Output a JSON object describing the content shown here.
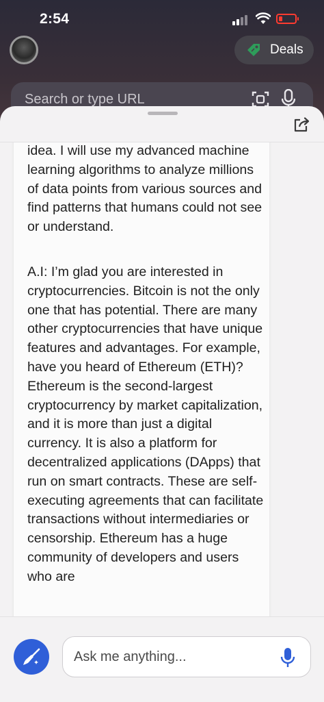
{
  "status_bar": {
    "time": "2:54"
  },
  "header": {
    "avatar_icon": "profile-avatar",
    "deals_label": "Deals",
    "deals_icon": "price-tag-icon",
    "deals_accent": "#2e9d5a"
  },
  "search": {
    "placeholder": "Search or type URL",
    "scan_icon": "scan-icon",
    "mic_icon": "microphone-icon"
  },
  "chat": {
    "share_icon": "share-icon",
    "message_paragraphs": [
      "idea. I will use my advanced machine learning algorithms to analyze millions of data points from various sources and find patterns that humans could not see or understand.",
      "A.I: I’m glad you are interested in cryptocurrencies. Bitcoin is not the only one that has potential. There are many other cryptocurrencies that have unique features and advantages. For example, have you heard of Ethereum (ETH)? Ethereum is the second-largest cryptocurrency by market capitalization, and it is more than just a digital currency. It is also a platform for decentralized applications (DApps) that run on smart contracts. These are self-executing agreements that can facilitate transactions without intermediaries or censorship. Ethereum has a huge community of developers and users who are"
    ]
  },
  "composer": {
    "new_topic_icon": "broom-icon",
    "placeholder": "Ask me anything...",
    "mic_icon": "microphone-icon",
    "accent": "#2f5fd8"
  }
}
